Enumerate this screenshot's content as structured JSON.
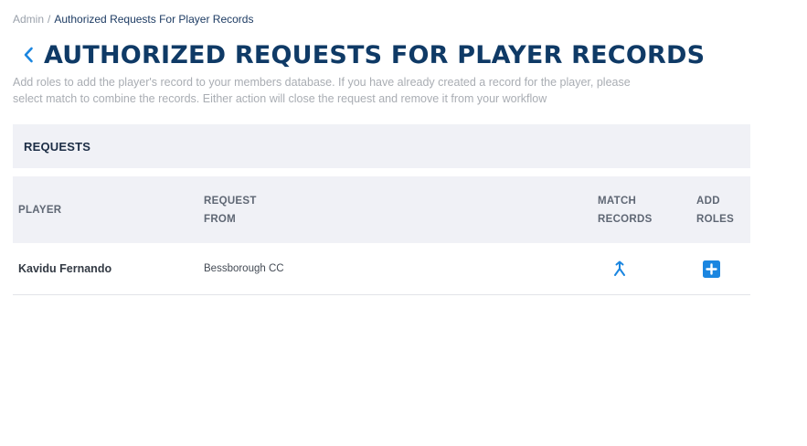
{
  "breadcrumb": {
    "root": "Admin",
    "separator": "/",
    "current": "Authorized Requests For Player Records"
  },
  "page": {
    "title": "AUTHORIZED REQUESTS FOR PLAYER RECORDS",
    "description": "Add roles to add the player's record to your members database. If you have already created a record for the player, please select match to combine the records. Either action will close the request and remove it from your workflow"
  },
  "requests": {
    "section_title": "REQUESTS",
    "columns": {
      "player": "PLAYER",
      "request_from_line1": "REQUEST",
      "request_from_line2": "FROM",
      "match_records_line1": "MATCH",
      "match_records_line2": "RECORDS",
      "add_roles_line1": "ADD",
      "add_roles_line2": "ROLES"
    },
    "rows": [
      {
        "player": "Kavidu Fernando",
        "request_from": "Bessborough CC",
        "match_icon": "merge-icon",
        "add_icon": "plus-square-icon"
      }
    ]
  },
  "colors": {
    "accent": "#1b86e0",
    "title": "#0f3a66",
    "panel_bg": "#f0f1f6"
  }
}
